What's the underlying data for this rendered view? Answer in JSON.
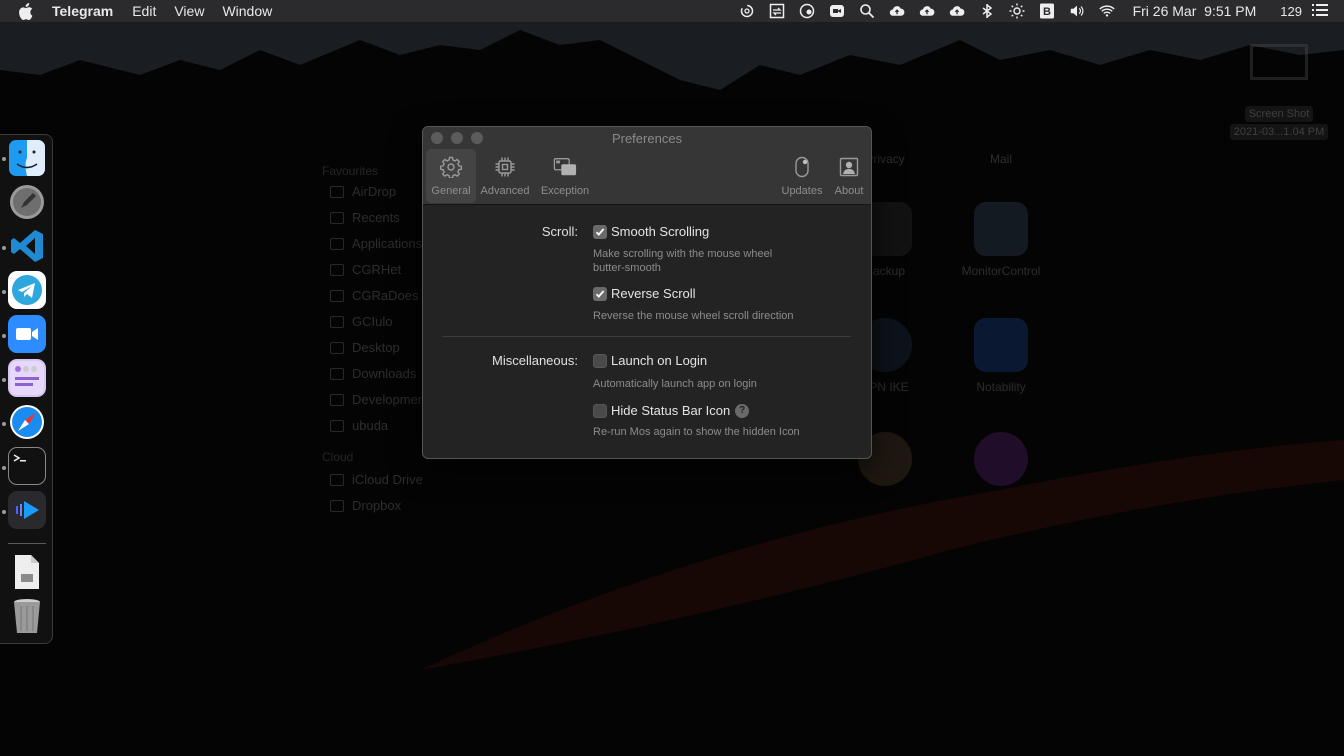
{
  "menubar": {
    "app_name": "Telegram",
    "menus": [
      "Edit",
      "View",
      "Window"
    ],
    "status_icons": [
      "sync-icon",
      "screen-switch-icon",
      "focus-icon",
      "zoom-icon",
      "search-icon",
      "cloud-upload-icon",
      "cloud-upload-icon",
      "cloud-upload-icon",
      "bluetooth-icon",
      "brightness-icon",
      "b-icon",
      "volume-icon",
      "wifi-icon"
    ],
    "clock": "Fri 26 Mar  9:51 PM",
    "count": "129"
  },
  "dock": {
    "apps": [
      {
        "name": "Finder",
        "icon": "finder-icon",
        "running": true
      },
      {
        "name": "Launchpad",
        "icon": "launchpad-icon",
        "running": false
      },
      {
        "name": "Visual Studio Code",
        "icon": "vscode-icon",
        "running": true
      },
      {
        "name": "Telegram",
        "icon": "telegram-icon",
        "running": true
      },
      {
        "name": "Zoom",
        "icon": "zoom-icon",
        "running": true
      },
      {
        "name": "Notes App",
        "icon": "notes-icon",
        "running": true
      },
      {
        "name": "Safari",
        "icon": "safari-icon",
        "running": true
      },
      {
        "name": "Terminal",
        "icon": "terminal-icon",
        "running": true
      },
      {
        "name": "Infuse",
        "icon": "player-icon",
        "running": true
      }
    ],
    "extras": [
      {
        "name": "Downloads",
        "icon": "document-icon"
      },
      {
        "name": "Trash",
        "icon": "trash-icon"
      }
    ]
  },
  "desktop_file": {
    "line1": "Screen Shot",
    "line2": "2021-03...1.04 PM"
  },
  "background_finder": {
    "sidebar_header_favourites": "Favourites",
    "sidebar": [
      "AirDrop",
      "Recents",
      "Applications",
      "CGRHet",
      "CGRaDoes",
      "GCIulo",
      "Desktop",
      "Downloads",
      "Development",
      "ubuda"
    ],
    "sidebar_header_cloud": "Cloud",
    "cloud": [
      "iCloud Drive",
      "Dropbox"
    ],
    "apps": [
      "Privacy",
      "Mail",
      "Backup",
      "MonitorControl",
      "VPN IKE",
      "Notability"
    ]
  },
  "preferences": {
    "title": "Preferences",
    "tabs": [
      {
        "label": "General",
        "icon": "gear-icon",
        "active": true
      },
      {
        "label": "Advanced",
        "icon": "chip-icon",
        "active": false
      },
      {
        "label": "Exception",
        "icon": "windows-icon",
        "active": false
      },
      {
        "label": "Updates",
        "icon": "mouse-icon",
        "active": false
      },
      {
        "label": "About",
        "icon": "person-icon",
        "active": false
      }
    ],
    "scroll_label": "Scroll:",
    "smooth_scrolling": {
      "label": "Smooth Scrolling",
      "checked": true,
      "desc_line1": "Make scrolling with the mouse wheel",
      "desc_line2": "butter-smooth"
    },
    "reverse_scroll": {
      "label": "Reverse Scroll",
      "checked": true,
      "desc": "Reverse the mouse wheel scroll direction"
    },
    "misc_label": "Miscellaneous:",
    "launch_on_login": {
      "label": "Launch on Login",
      "checked": false,
      "desc": "Automatically launch app on login"
    },
    "hide_status_bar_icon": {
      "label": "Hide Status Bar Icon",
      "checked": false,
      "desc": "Re-run Mos again to show the hidden Icon",
      "help": "?"
    }
  }
}
